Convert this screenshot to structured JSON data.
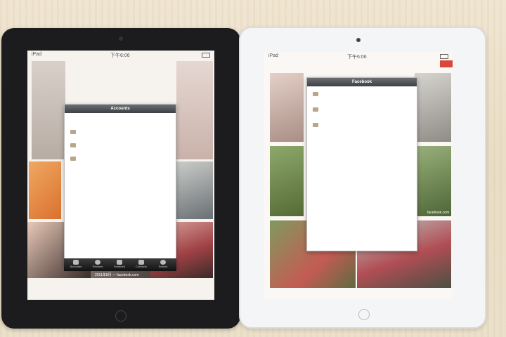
{
  "left_ipad": {
    "status": {
      "carrier": "iPad",
      "time": "下午6:06"
    },
    "popover_title": "Accounts",
    "list_rows": 3,
    "tabs": [
      {
        "label": "Accounts",
        "icon": "person-icon"
      },
      {
        "label": "Recents",
        "icon": "clock-icon"
      },
      {
        "label": "Featured",
        "icon": "people-icon"
      },
      {
        "label": "Contacts",
        "icon": "grid-icon"
      },
      {
        "label": "Search",
        "icon": "search-icon"
      }
    ],
    "photo_caption": "2011年8月 — facebook.com"
  },
  "right_ipad": {
    "status": {
      "carrier": "iPad",
      "time": "下午6:06"
    },
    "popover_title": "Facebook",
    "list_rows": 3,
    "photo_caption": "facebook.com"
  },
  "colors": {
    "table": "#eadfc8",
    "black_bezel": "#1c1c1e",
    "white_bezel": "#f4f5f6",
    "accent_red": "#d9473a"
  }
}
